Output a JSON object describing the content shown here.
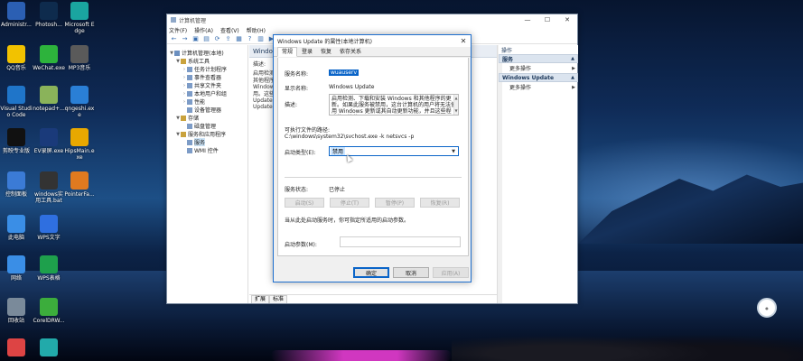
{
  "colors": {
    "accent": "#0a64c8",
    "dialog_border": "#1e6fcf",
    "action_header": "#dbe4ef"
  },
  "desktop": {
    "icons": [
      {
        "label": "Administr...",
        "icon": "admin-icon",
        "color": "#2b5fb3"
      },
      {
        "label": "Photosh...",
        "icon": "photoshop-icon",
        "color": "#0e2b4d"
      },
      {
        "label": "Microsoft Edge",
        "icon": "edge-icon",
        "color": "#1aa5a0"
      },
      {
        "label": "QQ音乐",
        "icon": "qq-music-icon",
        "color": "#f2c200"
      },
      {
        "label": "WeChat.exe",
        "icon": "wechat-icon",
        "color": "#2db33c"
      },
      {
        "label": "MP3音乐",
        "icon": "mp3-icon",
        "color": "#5a5a5a"
      },
      {
        "label": "Visual Studio Code",
        "icon": "vscode-icon",
        "color": "#1f75c9"
      },
      {
        "label": "notepad+...",
        "icon": "notepad-icon",
        "color": "#8ab35a"
      },
      {
        "label": "qngeshi.exe",
        "icon": "qngeshi-icon",
        "color": "#2a7fd6"
      },
      {
        "label": "剪映专业版",
        "icon": "jianying-icon",
        "color": "#111111"
      },
      {
        "label": "EV录屏.exe",
        "icon": "ev-recorder-icon",
        "color": "#1a3a7a"
      },
      {
        "label": "HipsMain.exe",
        "icon": "hips-icon",
        "color": "#e8a800"
      },
      {
        "label": "控制面板",
        "icon": "control-panel-icon",
        "color": "#3b7bd6"
      },
      {
        "label": "windows实用工具.bat",
        "icon": "bat-file-icon",
        "color": "#333333"
      },
      {
        "label": "PointerFa...",
        "icon": "pointer-icon",
        "color": "#e07a1f"
      },
      {
        "label": "此电脑",
        "icon": "this-pc-icon",
        "color": "#3a8ee6"
      },
      {
        "label": "WPS文字",
        "icon": "wps-writer-icon",
        "color": "#2f6fe0"
      },
      {
        "label": "网络",
        "icon": "network-icon",
        "color": "#3a8ee6"
      },
      {
        "label": "WPS表格",
        "icon": "wps-sheet-icon",
        "color": "#1ea04c"
      },
      {
        "label": "回收站",
        "icon": "recycle-bin-icon",
        "color": "#7a8a9a"
      },
      {
        "label": "CorelDRW...",
        "icon": "coreldraw-icon",
        "color": "#3cad3c"
      },
      {
        "label": "",
        "icon": "user-icon",
        "color": "#d44"
      },
      {
        "label": "",
        "icon": "app-icon",
        "color": "#2aa"
      }
    ]
  },
  "window": {
    "title": "计算机管理",
    "menu": [
      "文件(F)",
      "操作(A)",
      "查看(V)",
      "帮助(H)"
    ],
    "tree": [
      {
        "label": "计算机管理(本地)",
        "level": 0,
        "expander": "▼"
      },
      {
        "label": "系统工具",
        "level": 1,
        "expander": "▼"
      },
      {
        "label": "任务计划程序",
        "level": 2,
        "expander": "›"
      },
      {
        "label": "事件查看器",
        "level": 2,
        "expander": "›"
      },
      {
        "label": "共享文件夹",
        "level": 2,
        "expander": "›"
      },
      {
        "label": "本地用户和组",
        "level": 2,
        "expander": "›"
      },
      {
        "label": "性能",
        "level": 2,
        "expander": "›"
      },
      {
        "label": "设备管理器",
        "level": 2,
        "expander": ""
      },
      {
        "label": "存储",
        "level": 1,
        "expander": "▼"
      },
      {
        "label": "磁盘管理",
        "level": 2,
        "expander": ""
      },
      {
        "label": "服务和应用程序",
        "level": 1,
        "expander": "▼"
      },
      {
        "label": "服务",
        "level": 2,
        "expander": ""
      },
      {
        "label": "WMI 控件",
        "level": 2,
        "expander": ""
      }
    ],
    "center": {
      "header": "Windows",
      "lines": [
        "描述:",
        "启用检测、",
        "其他程序的",
        "Windows",
        "用。这些(",
        "Update 代",
        "Update 或"
      ],
      "tabs": [
        "扩展",
        "标准"
      ]
    },
    "actions": {
      "title": "操作",
      "groups": [
        {
          "header": "服务",
          "item": "更多操作"
        },
        {
          "header": "Windows Update",
          "item": "更多操作"
        }
      ]
    }
  },
  "dialog": {
    "title": "Windows Update 的属性(本地计算机)",
    "tabs": [
      "常规",
      "登录",
      "恢复",
      "依存关系"
    ],
    "service_name_label": "服务名称:",
    "service_name_value": "wuauserv",
    "display_name_label": "显示名称:",
    "display_name_value": "Windows Update",
    "desc_label": "描述:",
    "desc_value": "启用检测、下载和安装 Windows 和其他程序的更新。如果此服务被禁用，这台计算机的用户将无法使用 Windows 更新或其自动更新功能，并且这些程序将无法使用",
    "path_label": "可执行文件的路径:",
    "path_value": "C:\\windows\\system32\\svchost.exe -k netsvcs -p",
    "startup_label": "启动类型(E):",
    "startup_value": "禁用",
    "status_label": "服务状态:",
    "status_value": "已停止",
    "btn_start": "启动(S)",
    "btn_stop": "停止(T)",
    "btn_pause": "暂停(P)",
    "btn_resume": "恢复(R)",
    "hint": "当从此处启动服务时，你可指定所适用的启动参数。",
    "param_label": "启动参数(M):",
    "param_value": "",
    "ok": "确定",
    "cancel": "取消",
    "apply": "应用(A)"
  }
}
